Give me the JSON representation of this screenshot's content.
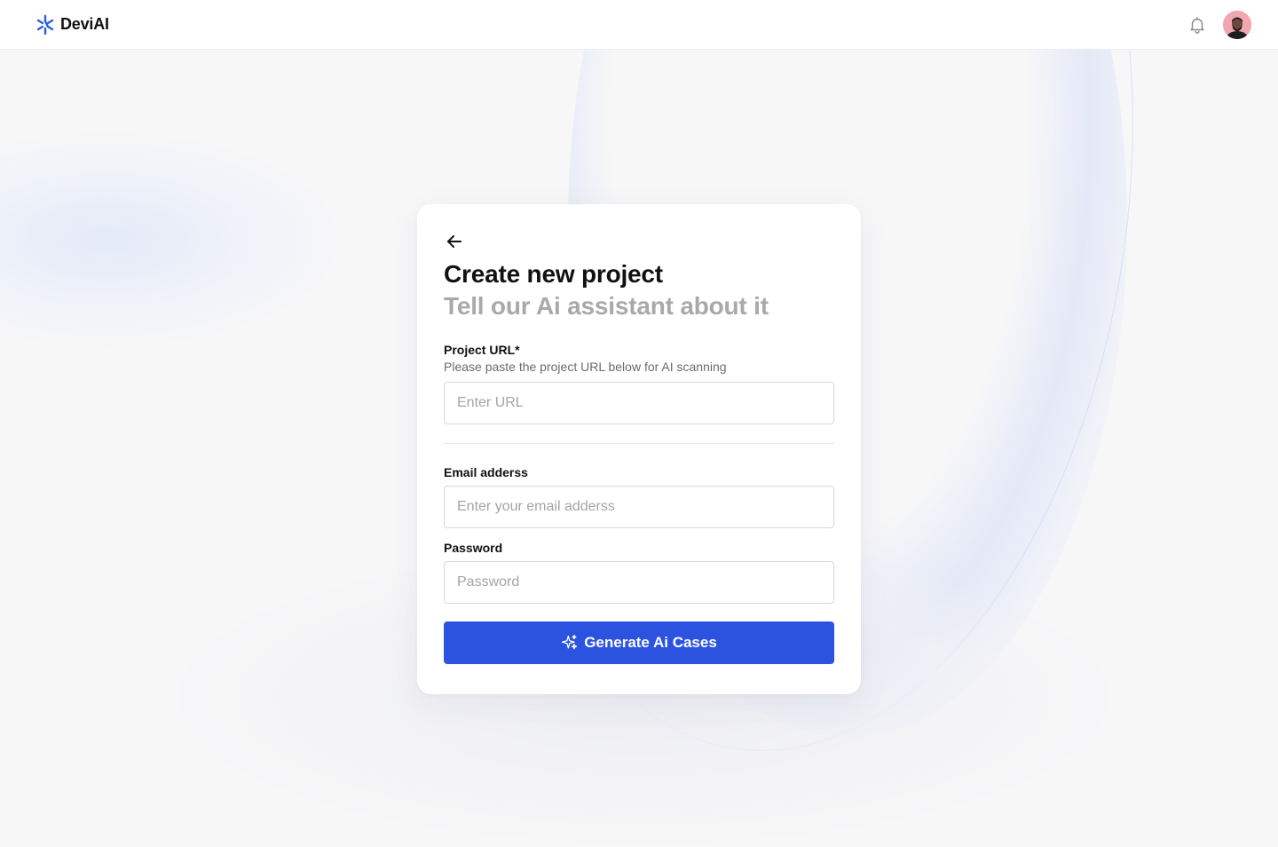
{
  "header": {
    "brand_name": "DeviAI",
    "logo_icon": "brand-logo-icon",
    "notification_icon": "bell-icon",
    "avatar_icon": "user-avatar"
  },
  "form": {
    "back_icon": "arrow-left-icon",
    "title": "Create new project",
    "subtitle": "Tell our Ai assistant about it",
    "project_url": {
      "label": "Project URL*",
      "help": "Please paste the project URL below for AI scanning",
      "placeholder": "Enter URL",
      "value": ""
    },
    "email": {
      "label": "Email adderss",
      "placeholder": "Enter your email adderss",
      "value": ""
    },
    "password": {
      "label": "Password",
      "placeholder": "Password",
      "value": ""
    },
    "submit": {
      "label": "Generate Ai Cases",
      "icon": "sparkle-icon"
    }
  },
  "colors": {
    "accent": "#2c53e0",
    "brand_logo": "#2c5be6",
    "page_background": "#f7f7f8",
    "subtitle_text": "#a9a9ad"
  }
}
